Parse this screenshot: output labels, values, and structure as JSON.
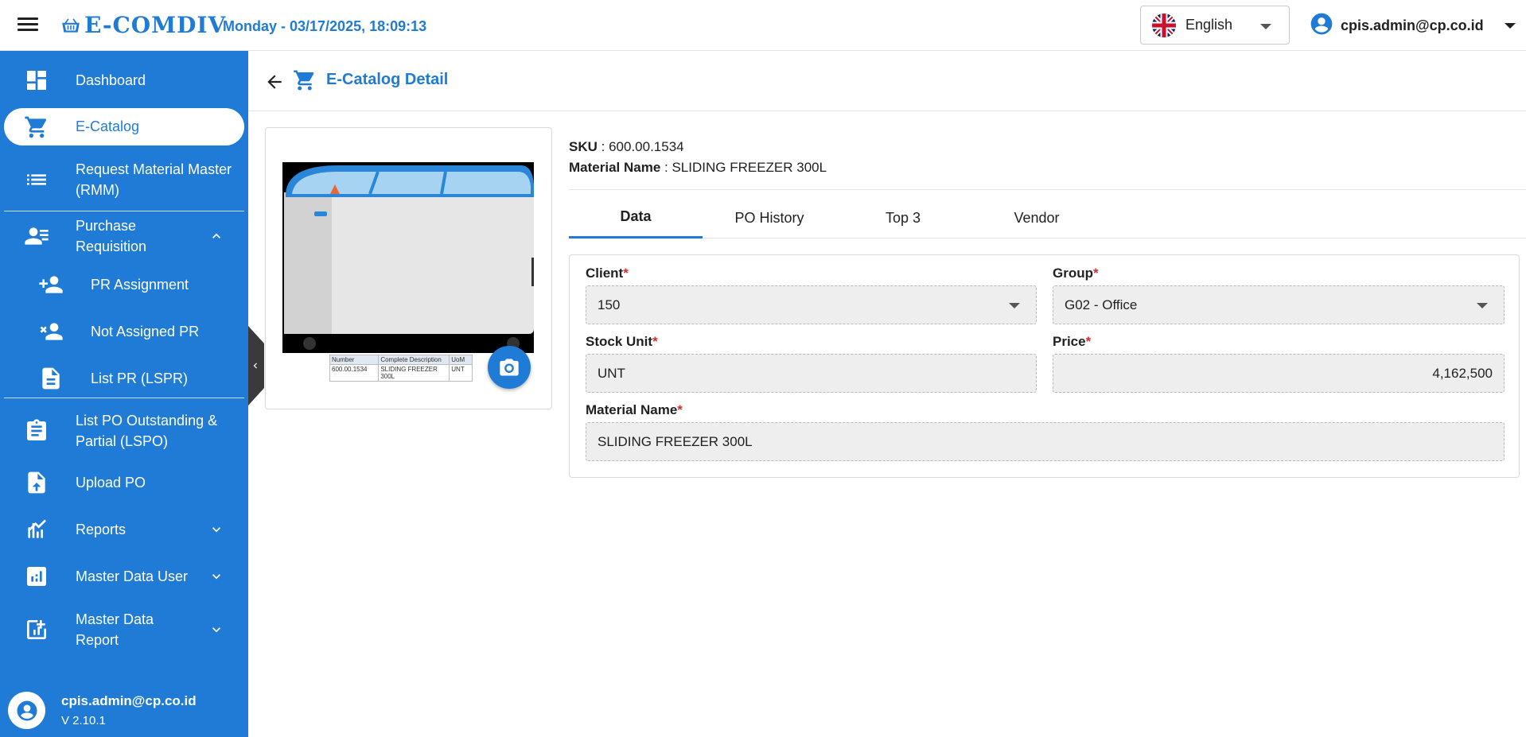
{
  "app": {
    "brand": "E-COMDIV",
    "datetime": "Monday - 03/17/2025, 18:09:13",
    "language": "English",
    "user_email": "cpis.admin@cp.co.id"
  },
  "sidebar": {
    "items": {
      "dashboard": "Dashboard",
      "ecatalog": "E-Catalog",
      "rmm": "Request Material Master (RMM)",
      "pr": "Purchase Requisition",
      "pr_assignment": "PR Assignment",
      "not_assigned": "Not Assigned PR",
      "lspr": "List PR (LSPR)",
      "lspo": "List PO Outstanding & Partial (LSPO)",
      "upload_po": "Upload PO",
      "reports": "Reports",
      "mdu": "Master Data User",
      "mdr": "Master Data Report"
    },
    "footer": {
      "email": "cpis.admin@cp.co.id",
      "version": "V 2.10.1"
    }
  },
  "page": {
    "title": "E-Catalog Detail",
    "sku_label": "SKU",
    "sku": "600.00.1534",
    "material_label": "Material Name",
    "material": "SLIDING FREEZER 300L",
    "image_table": {
      "headers": [
        "Number",
        "Complete Description",
        "UoM"
      ],
      "row": [
        "600.00.1534",
        "SLIDING FREEZER 300L",
        "UNT"
      ]
    }
  },
  "tabs": {
    "data": "Data",
    "po_history": "PO History",
    "top3": "Top 3",
    "vendor": "Vendor"
  },
  "form": {
    "client_label": "Client",
    "client": "150",
    "group_label": "Group",
    "group": "G02 - Office",
    "stock_unit_label": "Stock Unit",
    "stock_unit": "UNT",
    "price_label": "Price",
    "price": "4,162,500",
    "material_label": "Material Name",
    "material": "SLIDING FREEZER 300L",
    "required_mark": "*"
  },
  "colors": {
    "primary": "#1f7bd6",
    "required": "#d32f2f"
  },
  "icons": [
    "menu-icon",
    "basket-icon",
    "uk-flag-icon",
    "account-circle-icon",
    "dashboard-icon",
    "cart-icon",
    "list-icon",
    "person-list-icon",
    "person-add-icon",
    "person-remove-icon",
    "file-icon",
    "clipboard-icon",
    "file-upload-icon",
    "chart-icon",
    "analytics-icon",
    "report-add-icon",
    "chevron-up-icon",
    "chevron-down-icon",
    "chevron-left-icon",
    "arrow-back-icon",
    "camera-icon"
  ]
}
